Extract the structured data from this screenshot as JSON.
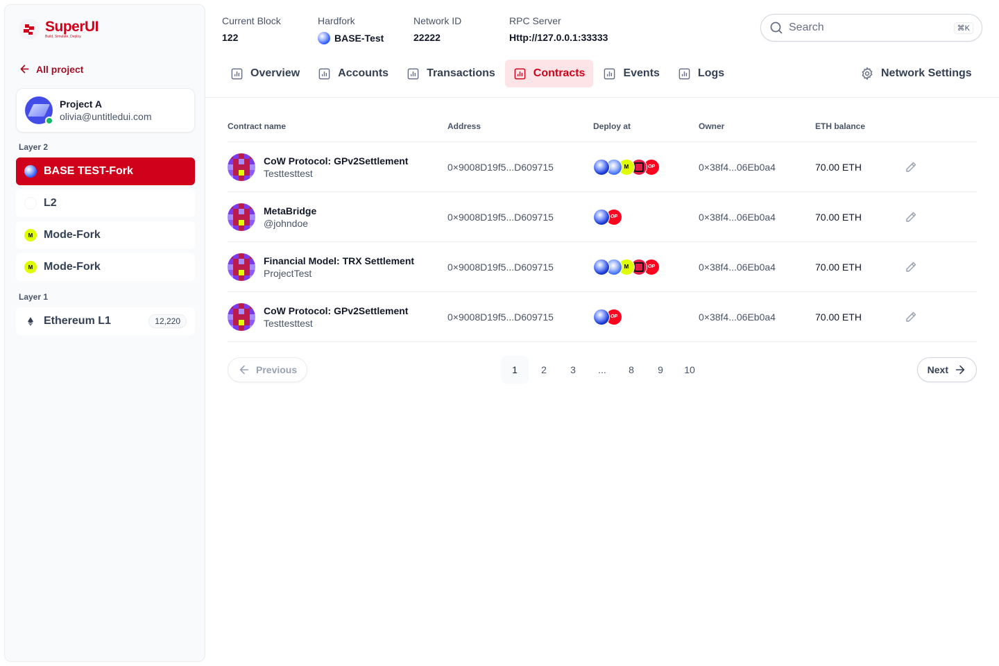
{
  "brand": {
    "name": "SuperUI",
    "tagline": "Build, Simulate, Deploy"
  },
  "sidebar": {
    "back_label": "All project",
    "project": {
      "name": "Project A",
      "email": "olivia@untitledui.com"
    },
    "layer2_label": "Layer 2",
    "layer1_label": "Layer 1",
    "layer2_items": [
      {
        "label": "BASE TEST-Fork",
        "icon": "base-icon",
        "active": true
      },
      {
        "label": "L2",
        "icon": "l2-icon",
        "active": false
      },
      {
        "label": "Mode-Fork",
        "icon": "mode-icon",
        "icon_text": "M",
        "active": false
      },
      {
        "label": "Mode-Fork",
        "icon": "mode-icon",
        "icon_text": "M",
        "active": false
      }
    ],
    "layer1_items": [
      {
        "label": "Ethereum L1",
        "icon": "ethereum-icon",
        "badge": "12,220"
      }
    ]
  },
  "header": {
    "current_block": {
      "label": "Current Block",
      "value": "122"
    },
    "hardfork": {
      "label": "Hardfork",
      "value": "BASE-Test"
    },
    "network_id": {
      "label": "Network ID",
      "value": "22222"
    },
    "rpc_server": {
      "label": "RPC Server",
      "value": "Http://127.0.0.1:33333"
    },
    "search": {
      "placeholder": "Search",
      "shortcut": "⌘K"
    }
  },
  "tabs": [
    {
      "label": "Overview",
      "active": false
    },
    {
      "label": "Accounts",
      "active": false
    },
    {
      "label": "Transactions",
      "active": false
    },
    {
      "label": "Contracts",
      "active": true
    },
    {
      "label": "Events",
      "active": false
    },
    {
      "label": "Logs",
      "active": false
    }
  ],
  "network_settings_label": "Network Settings",
  "table": {
    "columns": {
      "name": "Contract name",
      "address": "Address",
      "deploy": "Deploy at",
      "owner": "Owner",
      "balance": "ETH balance"
    },
    "rows": [
      {
        "name": "CoW Protocol: GPv2Settlement",
        "sub": "Testtesttest",
        "address": "0×9008D19f5...D609715",
        "chains": [
          "base",
          "base2",
          "mode",
          "polygon",
          "op"
        ],
        "owner": "0×38f4...06Eb0a4",
        "balance": "70.00 ETH"
      },
      {
        "name": "MetaBridge",
        "sub": "@johndoe",
        "address": "0×9008D19f5...D609715",
        "chains": [
          "base",
          "op"
        ],
        "owner": "0×38f4...06Eb0a4",
        "balance": "70.00 ETH"
      },
      {
        "name": "Financial Model: TRX Settlement",
        "sub": "ProjectTest",
        "address": "0×9008D19f5...D609715",
        "chains": [
          "base",
          "base2",
          "mode",
          "polygon",
          "op"
        ],
        "owner": "0×38f4...06Eb0a4",
        "balance": "70.00 ETH"
      },
      {
        "name": "CoW Protocol: GPv2Settlement",
        "sub": "Testtesttest",
        "address": "0×9008D19f5...D609715",
        "chains": [
          "base",
          "op"
        ],
        "owner": "0×38f4...06Eb0a4",
        "balance": "70.00 ETH"
      }
    ],
    "chain_labels": {
      "mode": "M",
      "op": "OP"
    }
  },
  "pagination": {
    "previous_label": "Previous",
    "next_label": "Next",
    "pages": [
      "1",
      "2",
      "3",
      "...",
      "8",
      "9",
      "10"
    ],
    "current_page": "1"
  },
  "colors": {
    "brand": "#d0021b",
    "active_tab_bg": "#fde4e7",
    "online": "#12b76a",
    "mode": "#dffe00",
    "op": "#ff0420"
  }
}
